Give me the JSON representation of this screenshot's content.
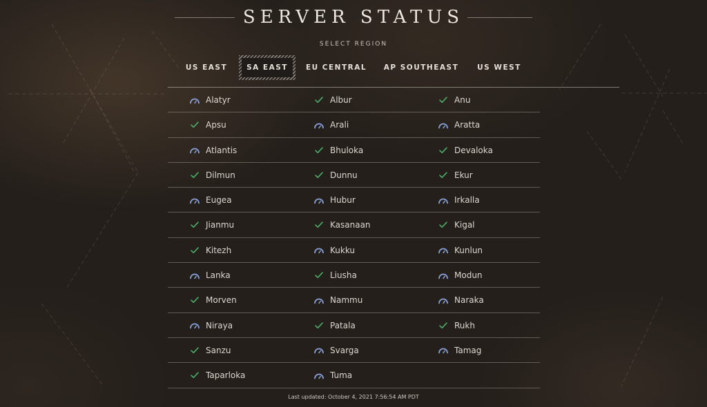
{
  "header": {
    "title": "SERVER STATUS",
    "subtitle": "SELECT REGION"
  },
  "tabs": [
    {
      "label": "US EAST",
      "active": false
    },
    {
      "label": "SA EAST",
      "active": true
    },
    {
      "label": "EU CENTRAL",
      "active": false
    },
    {
      "label": "AP SOUTHEAST",
      "active": false
    },
    {
      "label": "US WEST",
      "active": false
    }
  ],
  "status_legend": {
    "up": {
      "icon": "check-icon",
      "color": "#4caf6a"
    },
    "high_population": {
      "icon": "gauge-icon",
      "color": "#8aa0d8"
    }
  },
  "servers": [
    {
      "name": "Alatyr",
      "status": "high_population"
    },
    {
      "name": "Albur",
      "status": "up"
    },
    {
      "name": "Anu",
      "status": "up"
    },
    {
      "name": "Apsu",
      "status": "up"
    },
    {
      "name": "Arali",
      "status": "high_population"
    },
    {
      "name": "Aratta",
      "status": "high_population"
    },
    {
      "name": "Atlantis",
      "status": "high_population"
    },
    {
      "name": "Bhuloka",
      "status": "up"
    },
    {
      "name": "Devaloka",
      "status": "up"
    },
    {
      "name": "Dilmun",
      "status": "up"
    },
    {
      "name": "Dunnu",
      "status": "up"
    },
    {
      "name": "Ekur",
      "status": "up"
    },
    {
      "name": "Eugea",
      "status": "high_population"
    },
    {
      "name": "Hubur",
      "status": "high_population"
    },
    {
      "name": "Irkalla",
      "status": "high_population"
    },
    {
      "name": "Jianmu",
      "status": "up"
    },
    {
      "name": "Kasanaan",
      "status": "up"
    },
    {
      "name": "Kigal",
      "status": "up"
    },
    {
      "name": "Kitezh",
      "status": "up"
    },
    {
      "name": "Kukku",
      "status": "high_population"
    },
    {
      "name": "Kunlun",
      "status": "high_population"
    },
    {
      "name": "Lanka",
      "status": "high_population"
    },
    {
      "name": "Liusha",
      "status": "up"
    },
    {
      "name": "Modun",
      "status": "high_population"
    },
    {
      "name": "Morven",
      "status": "up"
    },
    {
      "name": "Nammu",
      "status": "high_population"
    },
    {
      "name": "Naraka",
      "status": "high_population"
    },
    {
      "name": "Niraya",
      "status": "high_population"
    },
    {
      "name": "Patala",
      "status": "up"
    },
    {
      "name": "Rukh",
      "status": "up"
    },
    {
      "name": "Sanzu",
      "status": "up"
    },
    {
      "name": "Svarga",
      "status": "high_population"
    },
    {
      "name": "Tamag",
      "status": "high_population"
    },
    {
      "name": "Taparloka",
      "status": "up"
    },
    {
      "name": "Tuma",
      "status": "high_population"
    }
  ],
  "footer": {
    "last_updated": "Last updated: October 4, 2021 7:56:54 AM PDT"
  }
}
